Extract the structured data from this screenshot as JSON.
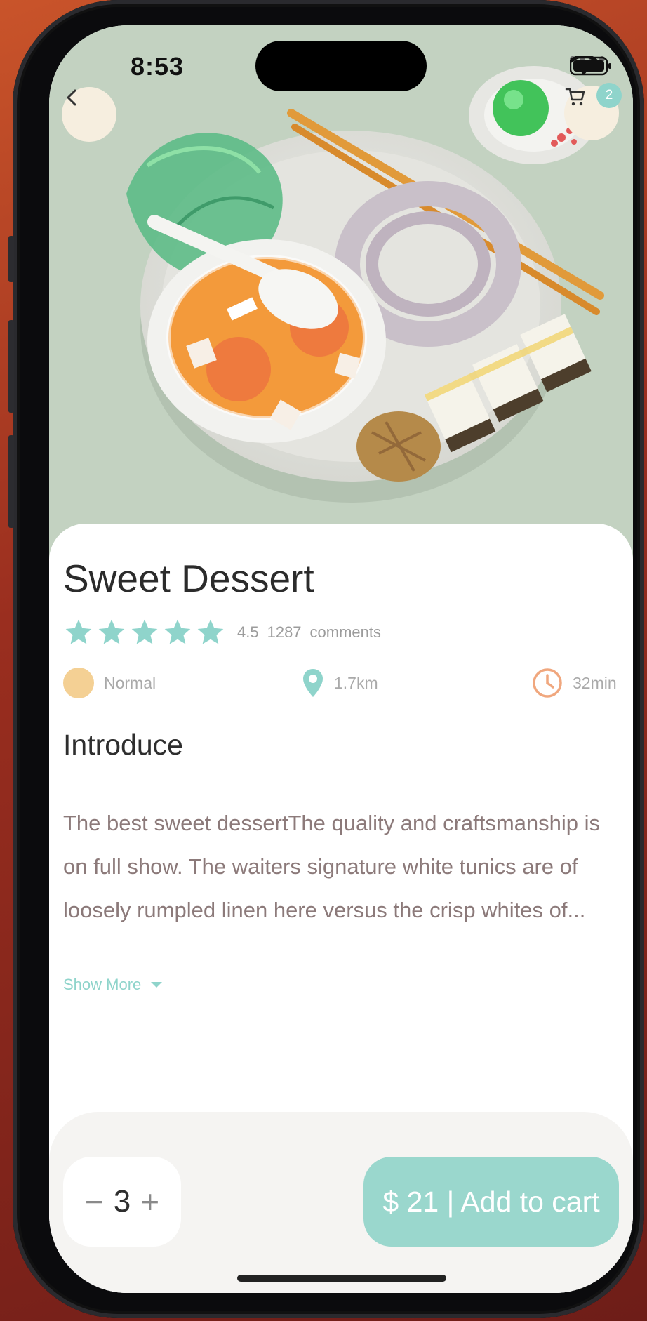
{
  "status_bar": {
    "time": "8:53"
  },
  "header": {
    "cart_badge_count": "2"
  },
  "product": {
    "title": "Sweet Dessert",
    "rating": "4.5",
    "rating_stars": 5,
    "comments_count": "1287",
    "comments_label": "comments",
    "difficulty": "Normal",
    "distance": "1.7km",
    "duration": "32min"
  },
  "intro": {
    "heading": "Introduce",
    "description": "The best sweet dessertThe quality and craftsmanship is on full show. The waiters signature white tunics are of loosely rumpled linen here versus the crisp whites of...",
    "show_more_label": "Show More"
  },
  "cart_bar": {
    "quantity": "3",
    "minus_label": "−",
    "plus_label": "+",
    "add_to_cart_label": "$ 21 | Add to cart"
  },
  "colors": {
    "accent": "#9ad7cd",
    "star": "#8fd4cb",
    "back_button_bg": "#f6eedf",
    "clock": "#f0a77e",
    "difficulty_dot": "#f4d094"
  }
}
